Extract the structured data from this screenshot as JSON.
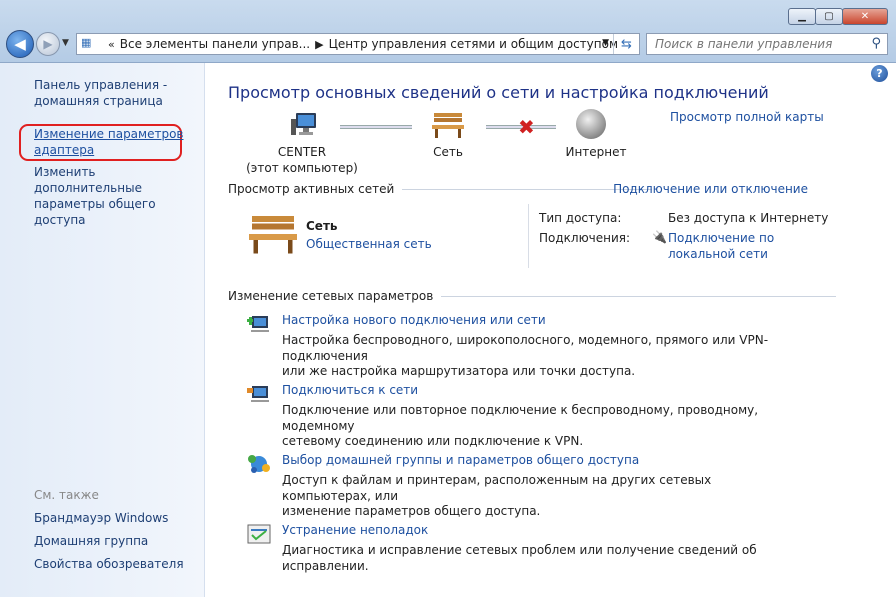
{
  "window": {
    "min": "▁",
    "max": "▢",
    "close": "✕"
  },
  "address": {
    "crumbs": [
      "Все элементы панели управ...",
      "Центр управления сетями и общим доступом"
    ],
    "search_placeholder": "Поиск в панели управления"
  },
  "sidebar": {
    "home": [
      "Панель управления -",
      "домашняя страница"
    ],
    "adapter": [
      "Изменение параметров",
      "адаптера"
    ],
    "sharing": [
      "Изменить дополнительные",
      "параметры общего доступа"
    ],
    "see_also": "См. также",
    "links": [
      "Брандмауэр Windows",
      "Домашняя группа",
      "Свойства обозревателя"
    ]
  },
  "main": {
    "title": "Просмотр основных сведений о сети и настройка подключений",
    "full_map": "Просмотр полной карты",
    "map": {
      "computer": "CENTER",
      "computer_sub": "(этот компьютер)",
      "network": "Сеть",
      "internet": "Интернет"
    },
    "active": {
      "header": "Просмотр активных сетей",
      "connect_link": "Подключение или отключение",
      "net_name": "Сеть",
      "net_type": "Общественная сеть",
      "access_label": "Тип доступа:",
      "access_value": "Без доступа к Интернету",
      "conn_label": "Подключения:",
      "conn_value": [
        "Подключение по",
        "локальной сети"
      ]
    },
    "change_header": "Изменение сетевых параметров",
    "tasks": [
      {
        "title": "Настройка нового подключения или сети",
        "desc": [
          "Настройка беспроводного, широкополосного, модемного, прямого или VPN-подключения",
          "или же настройка маршрутизатора или точки доступа."
        ]
      },
      {
        "title": "Подключиться к сети",
        "desc": [
          "Подключение или повторное подключение к беспроводному, проводному, модемному",
          "сетевому соединению или подключение к VPN."
        ]
      },
      {
        "title": "Выбор домашней группы и параметров общего доступа",
        "desc": [
          "Доступ к файлам и принтерам, расположенным на других сетевых компьютерах, или",
          "изменение параметров общего доступа."
        ]
      },
      {
        "title": "Устранение неполадок",
        "desc": [
          "Диагностика и исправление сетевых проблем или получение сведений об исправлении."
        ]
      }
    ]
  }
}
